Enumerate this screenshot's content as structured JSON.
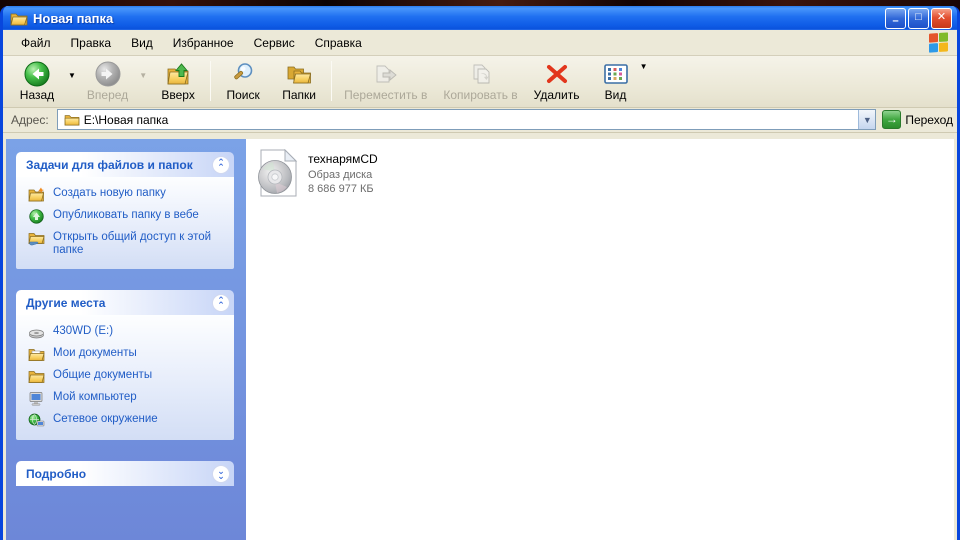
{
  "window": {
    "title": "Новая папка"
  },
  "titlebar": {
    "minimize": "–",
    "maximize": "□",
    "close": "✕"
  },
  "menu": {
    "items": [
      "Файл",
      "Правка",
      "Вид",
      "Избранное",
      "Сервис",
      "Справка"
    ]
  },
  "toolbar": {
    "back": "Назад",
    "forward": "Вперед",
    "up": "Вверх",
    "search": "Поиск",
    "folders": "Папки",
    "move_to": "Переместить в",
    "copy_to": "Копировать в",
    "delete": "Удалить",
    "view": "Вид"
  },
  "addressbar": {
    "label": "Адрес:",
    "value": "E:\\Новая папка",
    "go_label": "Переход"
  },
  "sidebar": {
    "tasks": {
      "title": "Задачи для файлов и папок",
      "items": [
        "Создать новую папку",
        "Опубликовать папку в вебе",
        "Открыть общий доступ к этой папке"
      ]
    },
    "places": {
      "title": "Другие места",
      "items": [
        "430WD (E:)",
        "Мои документы",
        "Общие документы",
        "Мой компьютер",
        "Сетевое окружение"
      ]
    },
    "details": {
      "title": "Подробно"
    }
  },
  "main": {
    "file": {
      "name": "технарямCD",
      "type": "Образ диска",
      "size": "8 686 977 КБ"
    }
  },
  "colors": {
    "titlebar_blue": "#1f6ff0",
    "window_border": "#0846dd",
    "toolbar_beige": "#ECE9D8",
    "sidebar_blue": "#7ba2e7",
    "link_blue": "#215DC6",
    "delete_red": "#e2361c",
    "go_green": "#3fa73f"
  }
}
